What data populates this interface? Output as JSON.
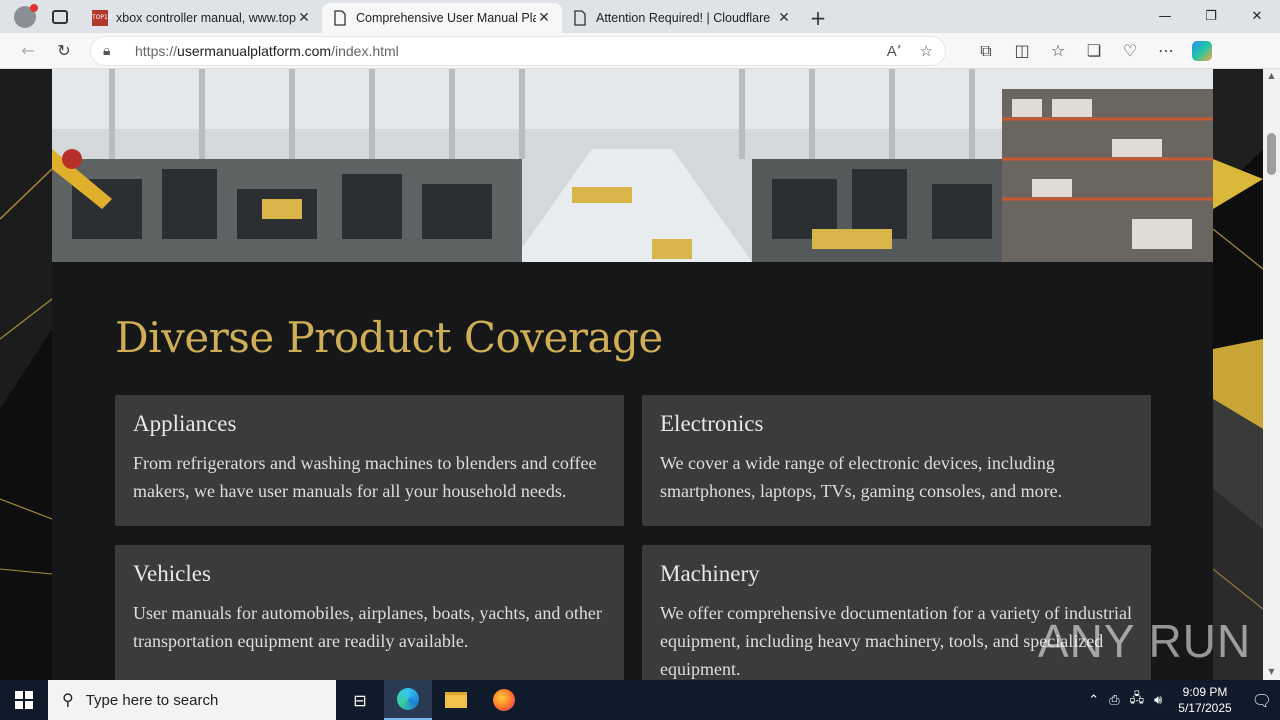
{
  "browser": {
    "tabs": [
      {
        "title": "xbox controller manual, www.top",
        "favicon": "top10-favicon",
        "active": false
      },
      {
        "title": "Comprehensive User Manual Plat",
        "favicon": "page-icon",
        "active": true
      },
      {
        "title": "Attention Required! | Cloudflare",
        "favicon": "page-icon",
        "active": false
      }
    ],
    "url_prefix": "https://",
    "url_domain": "usermanualplatform.com",
    "url_path": "/index.html"
  },
  "page": {
    "section_title": "Diverse Product Coverage",
    "cards": [
      {
        "title": "Appliances",
        "text": "From refrigerators and washing machines to blenders and coffee makers, we have user manuals for all your household needs."
      },
      {
        "title": "Electronics",
        "text": "We cover a wide range of electronic devices, including smartphones, laptops, TVs, gaming consoles, and more."
      },
      {
        "title": "Vehicles",
        "text": "User manuals for automobiles, airplanes, boats, yachts, and other transportation equipment are readily available."
      },
      {
        "title": "Machinery",
        "text": "We offer comprehensive documentation for a variety of industrial equipment, including heavy machinery, tools, and specialized equipment."
      }
    ],
    "accent_color": "#cfae56",
    "watermark": "ANY RUN"
  },
  "taskbar": {
    "search_placeholder": "Type here to search",
    "time": "9:09 PM",
    "date": "5/17/2025"
  }
}
